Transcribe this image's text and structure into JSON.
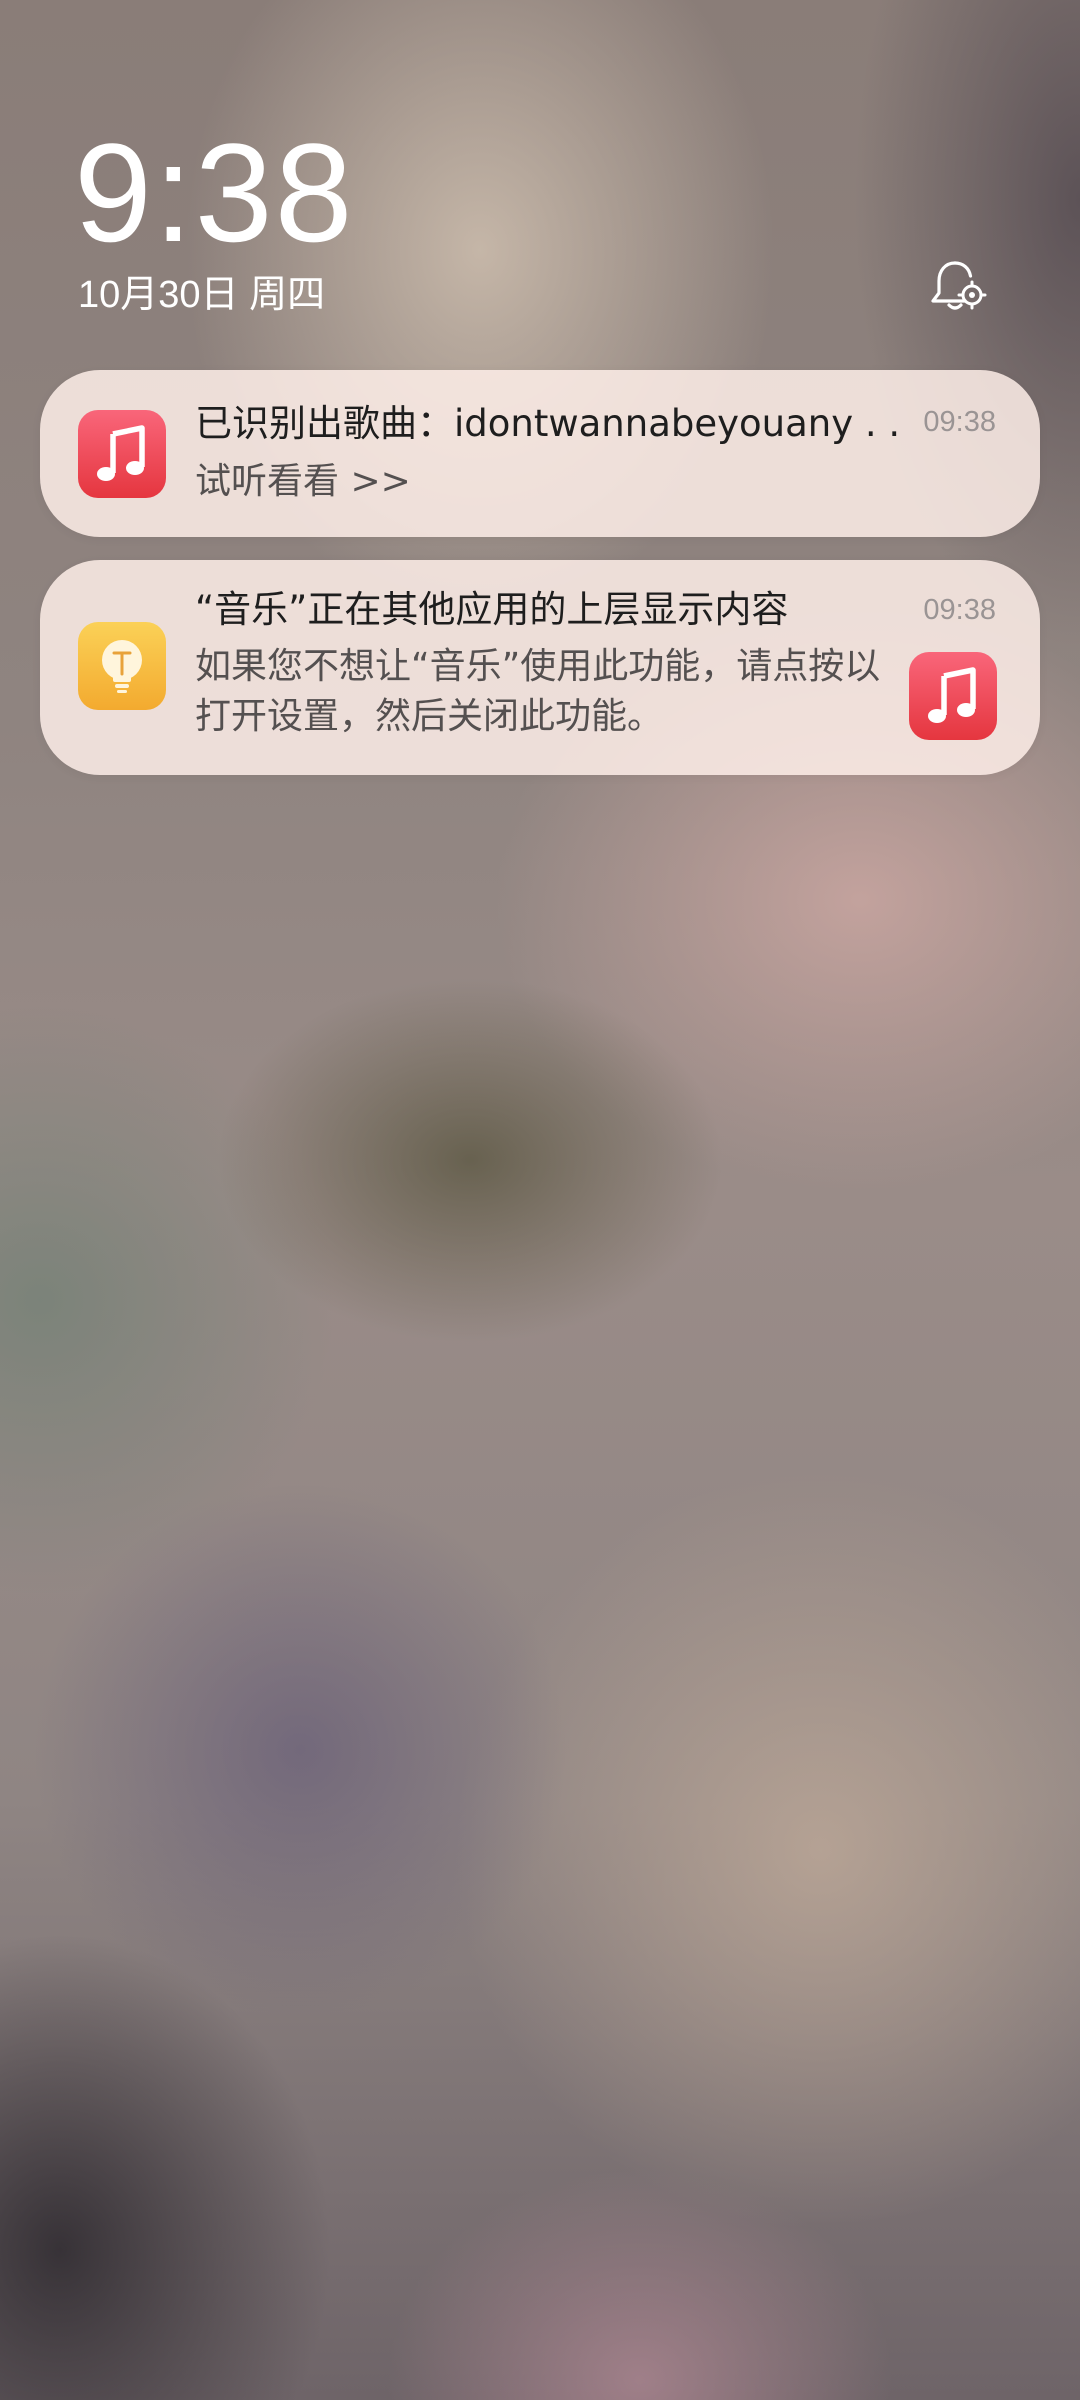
{
  "lockscreen": {
    "time": "9:38",
    "date": "10月30日  周四",
    "bell_icon": "bell-settings-icon"
  },
  "notifications": [
    {
      "app_icon": "music-note-icon",
      "title": "已识别出歌曲：idontwannabeyouany . .",
      "body": "试听看看 >>",
      "time": "09:38"
    },
    {
      "app_icon": "lightbulb-tips-icon",
      "title": "“音乐”正在其他应用的上层显示内容",
      "body": "如果您不想让“音乐”使用此功能，请点按以打开设置，然后关闭此功能。",
      "time": "09:38",
      "thumbnail_icon": "music-note-icon"
    }
  ],
  "colors": {
    "music_icon_top": "#f9667a",
    "music_icon_bottom": "#e5363f",
    "tips_icon_top": "#fbd157",
    "tips_icon_bottom": "#f3aa2f",
    "card_background": "#fff0ea"
  }
}
